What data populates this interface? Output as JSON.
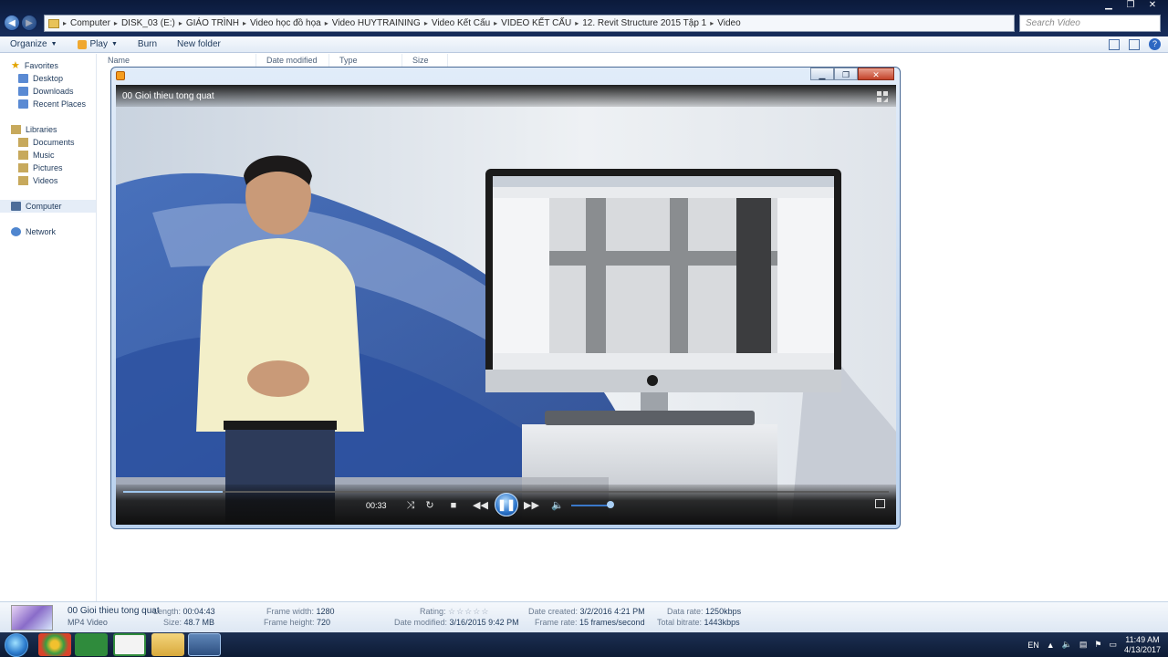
{
  "explorer": {
    "breadcrumb": [
      "Computer",
      "DISK_03 (E:)",
      "GIÁO TRÌNH",
      "Video học đồ họa",
      "Video HUYTRAINING",
      "Video Kết Cấu",
      "VIDEO KẾT CẤU",
      "12. Revit Structure 2015 Tập 1",
      "Video"
    ],
    "search_placeholder": "Search Video",
    "toolbar": {
      "organize": "Organize",
      "play": "Play",
      "burn": "Burn",
      "new_folder": "New folder"
    },
    "sidebar": {
      "favorites": "Favorites",
      "desktop": "Desktop",
      "downloads": "Downloads",
      "recent": "Recent Places",
      "libraries": "Libraries",
      "documents": "Documents",
      "music": "Music",
      "pictures": "Pictures",
      "videos": "Videos",
      "computer": "Computer",
      "network": "Network"
    },
    "columns": {
      "name": "Name",
      "date_modified": "Date modified",
      "type": "Type",
      "size": "Size"
    }
  },
  "player": {
    "title": "00 Gioi thieu tong quat",
    "time": "00:33",
    "progress": 0.13,
    "volume": 0.8
  },
  "details": {
    "file_name": "00 Gioi thieu tong quat",
    "file_type": "MP4 Video",
    "length_label": "Length:",
    "length": "00:04:43",
    "size_label": "Size:",
    "size": "48.7 MB",
    "frame_width_label": "Frame width:",
    "frame_width": "1280",
    "frame_height_label": "Frame height:",
    "frame_height": "720",
    "rating_label": "Rating:",
    "rating_stars": "☆☆☆☆☆",
    "date_modified_label": "Date modified:",
    "date_modified": "3/16/2015 9:42 PM",
    "date_created_label": "Date created:",
    "date_created": "3/2/2016 4:21 PM",
    "frame_rate_label": "Frame rate:",
    "frame_rate": "15 frames/second",
    "data_rate_label": "Data rate:",
    "data_rate": "1250kbps",
    "total_bitrate_label": "Total bitrate:",
    "total_bitrate": "1443kbps"
  },
  "taskbar": {
    "lang": "EN",
    "time": "11:49 AM",
    "date": "4/13/2017"
  },
  "colors": {
    "accent": "#2a72c8",
    "taskbar": "#0d1b35"
  }
}
